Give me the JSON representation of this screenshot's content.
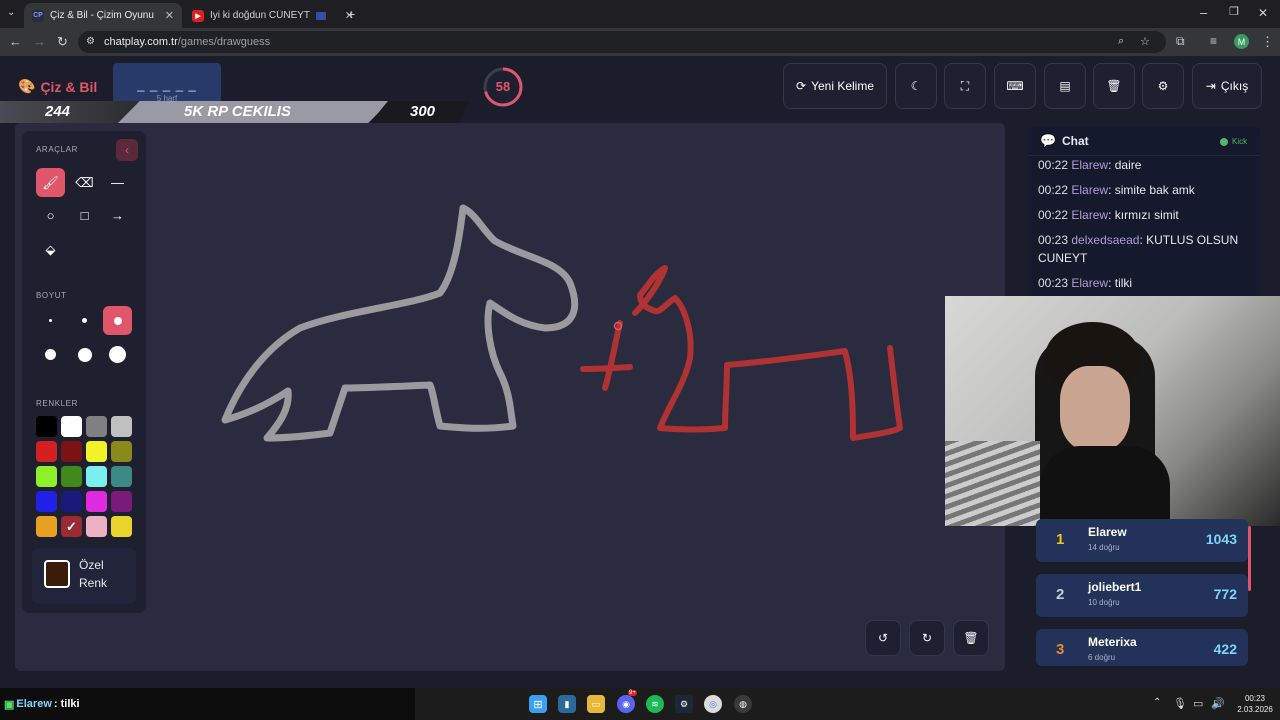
{
  "browser": {
    "tabs": [
      {
        "favicon": "CP",
        "title": "Çiz & Bil - Çizim Oyunu",
        "active": true
      },
      {
        "favicon": "▶",
        "title": "İyi ki doğdun CÜNEYT - İsm",
        "active": false
      }
    ],
    "url_host": "chatplay.com.tr",
    "url_path": "/games/drawguess",
    "profile_initial": "M"
  },
  "header": {
    "logo": "Çiz & Bil",
    "word_mask": "_ _ _ _ _",
    "word_hint": "5 harf",
    "timer": "58",
    "buttons": {
      "new_word": "Yeni Kelime",
      "exit": "Çıkış"
    }
  },
  "overlay": {
    "left_count": "244",
    "banner": "5K RP CEKILIS",
    "right_count": "300"
  },
  "tools": {
    "tools_title": "ARAÇLAR",
    "size_title": "BOYUT",
    "colors_title": "RENKLER",
    "custom_label_1": "Özel",
    "custom_label_2": "Renk",
    "custom_color": "#3a1d08",
    "palette": [
      "#000000",
      "#ffffff",
      "#808080",
      "#c0c0c0",
      "#d42020",
      "#7a1414",
      "#f2f22a",
      "#8a8a1c",
      "#8ef02a",
      "#3f8a1a",
      "#7aefef",
      "#3b8a86",
      "#2020e8",
      "#1a1a7a",
      "#e02ae0",
      "#7a1a7a",
      "#e8a020",
      "#9a2a33",
      "#ecb2c4",
      "#e8d42a"
    ]
  },
  "chat": {
    "title": "Chat",
    "status": "Kick",
    "messages": [
      {
        "time": "00:22",
        "user": "Elarew",
        "text": "daire"
      },
      {
        "time": "00:22",
        "user": "Elarew",
        "text": "simite bak amk"
      },
      {
        "time": "00:22",
        "user": "Elarew",
        "text": "kırmızı simit"
      },
      {
        "time": "00:23",
        "user": "delxedsaead",
        "text": "KUTLUS OLSUN CUNEYT"
      },
      {
        "time": "00:23",
        "user": "Elarew",
        "text": "tilki"
      }
    ]
  },
  "leaderboard": [
    {
      "rank": "1",
      "name": "Elarew",
      "sub": "14 doğru",
      "points": "1043",
      "rank_color": "#f0c419"
    },
    {
      "rank": "2",
      "name": "joliebert1",
      "sub": "10 doğru",
      "points": "772",
      "rank_color": "#c8ccd6"
    },
    {
      "rank": "3",
      "name": "Meterixa",
      "sub": "6 doğru",
      "points": "422",
      "rank_color": "#e08a3c"
    }
  ],
  "ticker": {
    "user": "Elarew",
    "text": ": tilki"
  },
  "taskbar": {
    "time": "00:23",
    "date": "2.03.2026",
    "discord_badge": "9+"
  },
  "colors": {
    "accent": "#e0566b",
    "chat_user": "#b59ad9",
    "points": "#7fd3ff"
  }
}
